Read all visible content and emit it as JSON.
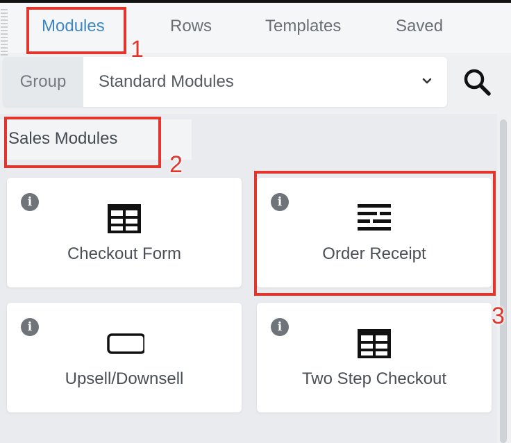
{
  "tabs": [
    {
      "label": "Modules",
      "active": true
    },
    {
      "label": "Rows",
      "active": false
    },
    {
      "label": "Templates",
      "active": false
    },
    {
      "label": "Saved",
      "active": false
    }
  ],
  "group": {
    "label": "Group",
    "selected": "Standard Modules"
  },
  "section": {
    "title": "Sales Modules"
  },
  "modules": [
    {
      "label": "Checkout Form",
      "icon": "table-icon"
    },
    {
      "label": "Order Receipt",
      "icon": "text-lines-icon"
    },
    {
      "label": "Upsell/Downsell",
      "icon": "button-outline-icon"
    },
    {
      "label": "Two Step Checkout",
      "icon": "table-icon"
    }
  ],
  "annotations": [
    "1",
    "2",
    "3"
  ],
  "colors": {
    "accent": "#3f86c3",
    "annotation": "#e2362c"
  }
}
